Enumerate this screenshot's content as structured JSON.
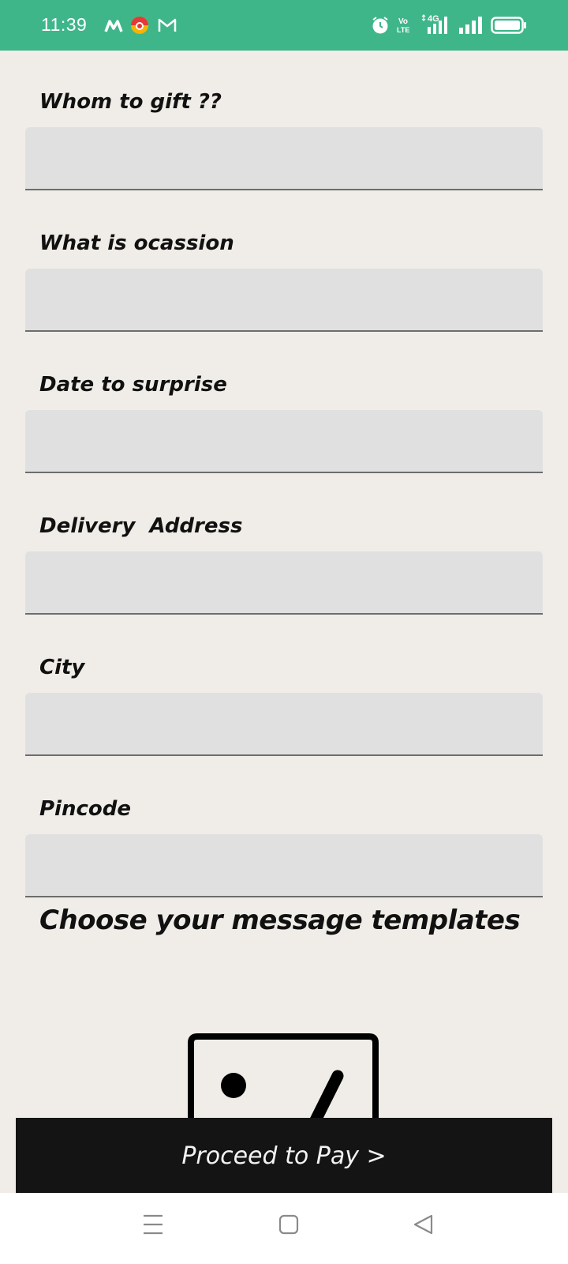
{
  "status_bar": {
    "time": "11:39",
    "color": "#3fb68a",
    "icons": [
      "m-app-icon",
      "colorful-app-icon",
      "gmail-icon",
      "alarm-icon",
      "volte-icon",
      "signal-4g-icon",
      "signal-icon",
      "battery-icon"
    ],
    "volte_text": "Vo LTE",
    "network_text": "4G"
  },
  "form": {
    "fields": [
      {
        "label": "Whom to gift ??",
        "value": ""
      },
      {
        "label": "What is ocassion",
        "value": ""
      },
      {
        "label": "Date to surprise",
        "value": ""
      },
      {
        "label": "Delivery  Address",
        "value": ""
      },
      {
        "label": "City",
        "value": ""
      },
      {
        "label": "Pincode",
        "value": ""
      }
    ]
  },
  "templates": {
    "title": "Choose your message templates",
    "thumbnail_icon": "image-placeholder-icon"
  },
  "pay_button": {
    "label": "Proceed to Pay >",
    "color": "#141414"
  },
  "nav_bar": {
    "icons": [
      "menu-icon",
      "home-square-icon",
      "back-triangle-icon"
    ]
  }
}
